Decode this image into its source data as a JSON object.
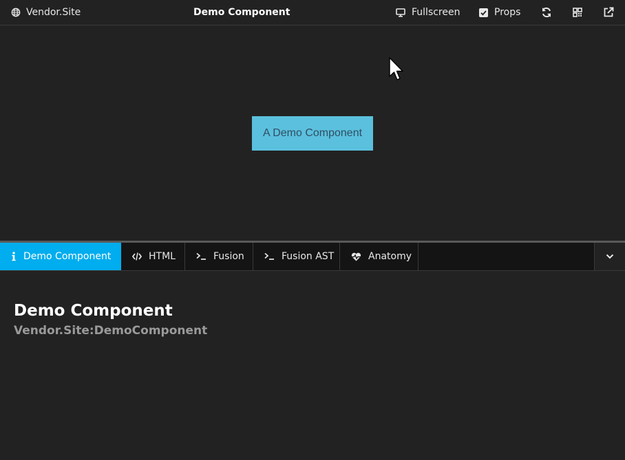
{
  "topbar": {
    "site_label": "Vendor.Site",
    "title": "Demo Component",
    "fullscreen_label": "Fullscreen",
    "props_label": "Props",
    "props_checked": true,
    "icons": [
      "globe-icon",
      "monitor-icon",
      "checkbox-icon",
      "refresh-icon",
      "qrcode-icon",
      "external-link-icon"
    ]
  },
  "preview": {
    "component_text": "A Demo Component",
    "component_bg": "#5bc0de"
  },
  "tabs": [
    {
      "label": "Demo Component",
      "icon": "info-icon",
      "active": true
    },
    {
      "label": "HTML",
      "icon": "code-icon",
      "active": false
    },
    {
      "label": "Fusion",
      "icon": "terminal-icon",
      "active": false
    },
    {
      "label": "Fusion AST",
      "icon": "terminal-icon",
      "active": false
    },
    {
      "label": "Anatomy",
      "icon": "heartbeat-icon",
      "active": false
    }
  ],
  "info": {
    "heading": "Demo Component",
    "prototype_name": "Vendor.Site:DemoComponent"
  },
  "colors": {
    "background": "#222222",
    "accent": "#00adee",
    "tabbar": "#141414",
    "muted_text": "#9a9a9a"
  }
}
